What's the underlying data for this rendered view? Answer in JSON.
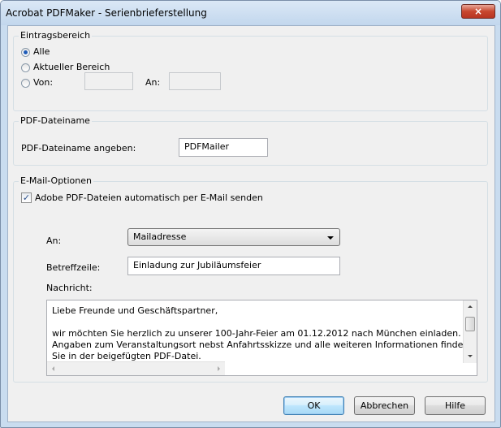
{
  "window": {
    "title": "Acrobat PDFMaker - Serienbrieferstellung",
    "close_glyph": "×"
  },
  "range_group": {
    "title": "Eintragsbereich",
    "options": [
      {
        "label": "Alle",
        "selected": true
      },
      {
        "label": "Aktueller Bereich",
        "selected": false
      },
      {
        "label": "Von:",
        "selected": false
      }
    ],
    "from_value": "",
    "to_label": "An:",
    "to_value": ""
  },
  "filename_group": {
    "title": "PDF-Dateiname",
    "label": "PDF-Dateiname angeben:",
    "value": "PDFMailer"
  },
  "email_group": {
    "title": "E-Mail-Optionen",
    "auto_send_label": "Adobe PDF-Dateien automatisch per E-Mail senden",
    "auto_send_checked": true,
    "checkmark": "✓",
    "to_label": "An:",
    "to_value": "Mailadresse",
    "subject_label": "Betreffzeile:",
    "subject_value": "Einladung zur Jubiläumsfeier",
    "message_label": "Nachricht:",
    "message_lines": [
      "Liebe Freunde und Geschäftspartner,",
      "",
      "wir möchten Sie herzlich zu unserer 100-Jahr-Feier am 01.12.2012 nach München einladen.",
      "Angaben zum Veranstaltungsort nebst Anfahrtsskizze und alle weiteren Informationen finden",
      "Sie in der beigefügten PDF-Datei."
    ]
  },
  "buttons": {
    "ok": "OK",
    "cancel": "Abbrechen",
    "help": "Hilfe"
  },
  "colors": {
    "accent": "#1e5bb8",
    "close_button": "#c8472f",
    "frame": "#c9dcef"
  }
}
